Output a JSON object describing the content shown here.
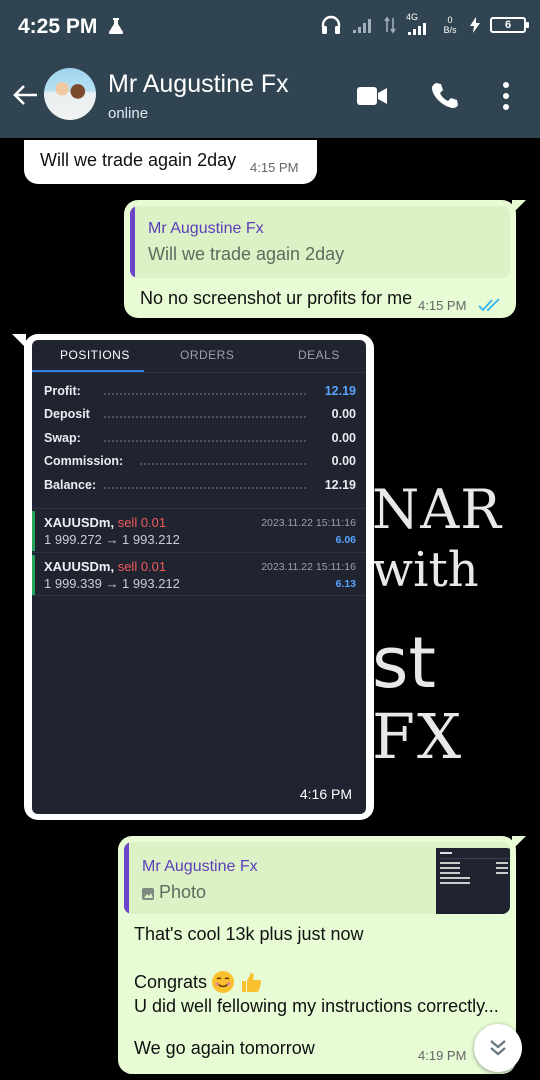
{
  "status_bar": {
    "time": "4:25 PM",
    "network": "4G",
    "speed_value": "0",
    "speed_unit": "B/s",
    "battery": "6"
  },
  "header": {
    "contact_name": "Mr Augustine Fx",
    "contact_status": "online"
  },
  "background_logo": [
    "NAR",
    "with",
    "st",
    "FX"
  ],
  "messages": [
    {
      "id": "m1",
      "direction": "incoming",
      "text": "Will we trade again 2day",
      "time": "4:15 PM"
    },
    {
      "id": "m2",
      "direction": "outgoing",
      "quote_name": "Mr Augustine Fx",
      "quote_text": "Will we trade again 2day",
      "text": "No no screenshot ur profits for me",
      "time": "4:15 PM",
      "read": true
    },
    {
      "id": "m3",
      "direction": "incoming",
      "type": "image",
      "time": "4:16 PM"
    },
    {
      "id": "m4",
      "direction": "outgoing",
      "quote_name": "Mr Augustine Fx",
      "quote_text": "Photo",
      "lines": [
        "That's cool 13k plus just now",
        "Congrats",
        "U did well fellowing my instructions correctly...",
        "We go again tomorrow"
      ],
      "time": "4:19 PM"
    }
  ],
  "trade_screenshot": {
    "tabs": [
      "POSITIONS",
      "ORDERS",
      "DEALS"
    ],
    "active_tab": "POSITIONS",
    "summary": [
      {
        "label": "Profit:",
        "value": "12.19"
      },
      {
        "label": "Deposit",
        "value": "0.00"
      },
      {
        "label": "Swap:",
        "value": "0.00"
      },
      {
        "label": "Commission:",
        "value": "0.00"
      },
      {
        "label": "Balance:",
        "value": "12.19"
      }
    ],
    "positions": [
      {
        "symbol": "XAUUSDm,",
        "side": "sell 0.01",
        "prices": "1 999.272 → 1 993.212",
        "date": "2023.11.22 15:11:16",
        "profit": "6.06"
      },
      {
        "symbol": "XAUUSDm,",
        "side": "sell 0.01",
        "prices": "1 999.339 → 1 993.212",
        "date": "2023.11.22 15:11:16",
        "profit": "6.13"
      }
    ]
  },
  "colors": {
    "header_bg": "#304551",
    "outgoing_bubble": "#e7fbd5",
    "incoming_bubble": "#ffffff",
    "quote_accent": "#6a43c7",
    "read_ticks": "#34b7f1",
    "sell": "#f25a5a",
    "profit_blue": "#5aa2ff"
  },
  "icons": [
    "flask-icon",
    "headphones-icon",
    "signal-icon",
    "battery-icon",
    "back-arrow-icon",
    "video-call-icon",
    "phone-icon",
    "more-vert-icon",
    "double-check-icon",
    "photo-icon",
    "smile-emoji-icon",
    "thumbs-up-emoji-icon",
    "chevrons-down-icon"
  ]
}
